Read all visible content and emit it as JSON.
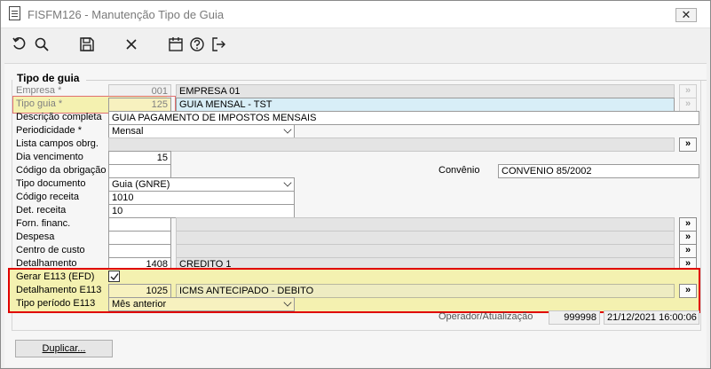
{
  "window": {
    "title": "FISFM126 - Manutenção Tipo de Guia",
    "close_glyph": "✕"
  },
  "toolbar": {
    "buttons": [
      {
        "name": "undo-icon"
      },
      {
        "name": "search-icon"
      },
      {
        "name": "save-icon"
      },
      {
        "name": "cancel-x-icon"
      },
      {
        "name": "calendar-icon"
      },
      {
        "name": "help-icon"
      },
      {
        "name": "exit-icon"
      }
    ]
  },
  "group": {
    "title": "Tipo de guia"
  },
  "lookup_glyph": "»",
  "form": {
    "empresa": {
      "label": "Empresa *",
      "code": "001",
      "desc": "EMPRESA 01"
    },
    "tipo_guia": {
      "label": "Tipo guia *",
      "code": "125",
      "desc": "GUIA MENSAL - TST"
    },
    "descricao": {
      "label": "Descrição completa",
      "value": "GUIA PAGAMENTO DE IMPOSTOS MENSAIS"
    },
    "periodicidade": {
      "label": "Periodicidade *",
      "value": "Mensal"
    },
    "lista_campos": {
      "label": "Lista campos obrg.",
      "value": ""
    },
    "dia_vencimento": {
      "label": "Dia vencimento",
      "value": "15"
    },
    "codigo_obrigacao": {
      "label": "Código da obrigação",
      "value": ""
    },
    "convenio": {
      "label": "Convênio",
      "value": "CONVENIO 85/2002"
    },
    "tipo_documento": {
      "label": "Tipo documento",
      "value": "Guia (GNRE)"
    },
    "codigo_receita": {
      "label": "Código receita",
      "value": "1010"
    },
    "det_receita": {
      "label": "Det. receita",
      "value": "10"
    },
    "forn_financ": {
      "label": "Forn. financ.",
      "code": "",
      "desc": ""
    },
    "despesa": {
      "label": "Despesa",
      "code": "",
      "desc": ""
    },
    "centro_custo": {
      "label": "Centro de custo",
      "code": "",
      "desc": ""
    },
    "detalhamento": {
      "label": "Detalhamento",
      "code": "1408",
      "desc": "CREDITO 1"
    },
    "gerar_e113": {
      "label": "Gerar E113 (EFD)",
      "checked": true
    },
    "detalhamento_e113": {
      "label": "Detalhamento E113",
      "code": "1025",
      "desc": "ICMS ANTECIPADO - DEBITO"
    },
    "tipo_periodo_e113": {
      "label": "Tipo período E113",
      "value": "Mês anterior"
    }
  },
  "footer": {
    "operador_label": "Operador/Atualização",
    "operador": "999998",
    "atualizacao": "21/12/2021 16:00:06",
    "duplicar_label": "Duplicar..."
  },
  "colors": {
    "highlight_box": "#e00000",
    "required_highlight": "#f4f1b0",
    "tipo_guia_desc_bg": "#d8eef7"
  }
}
